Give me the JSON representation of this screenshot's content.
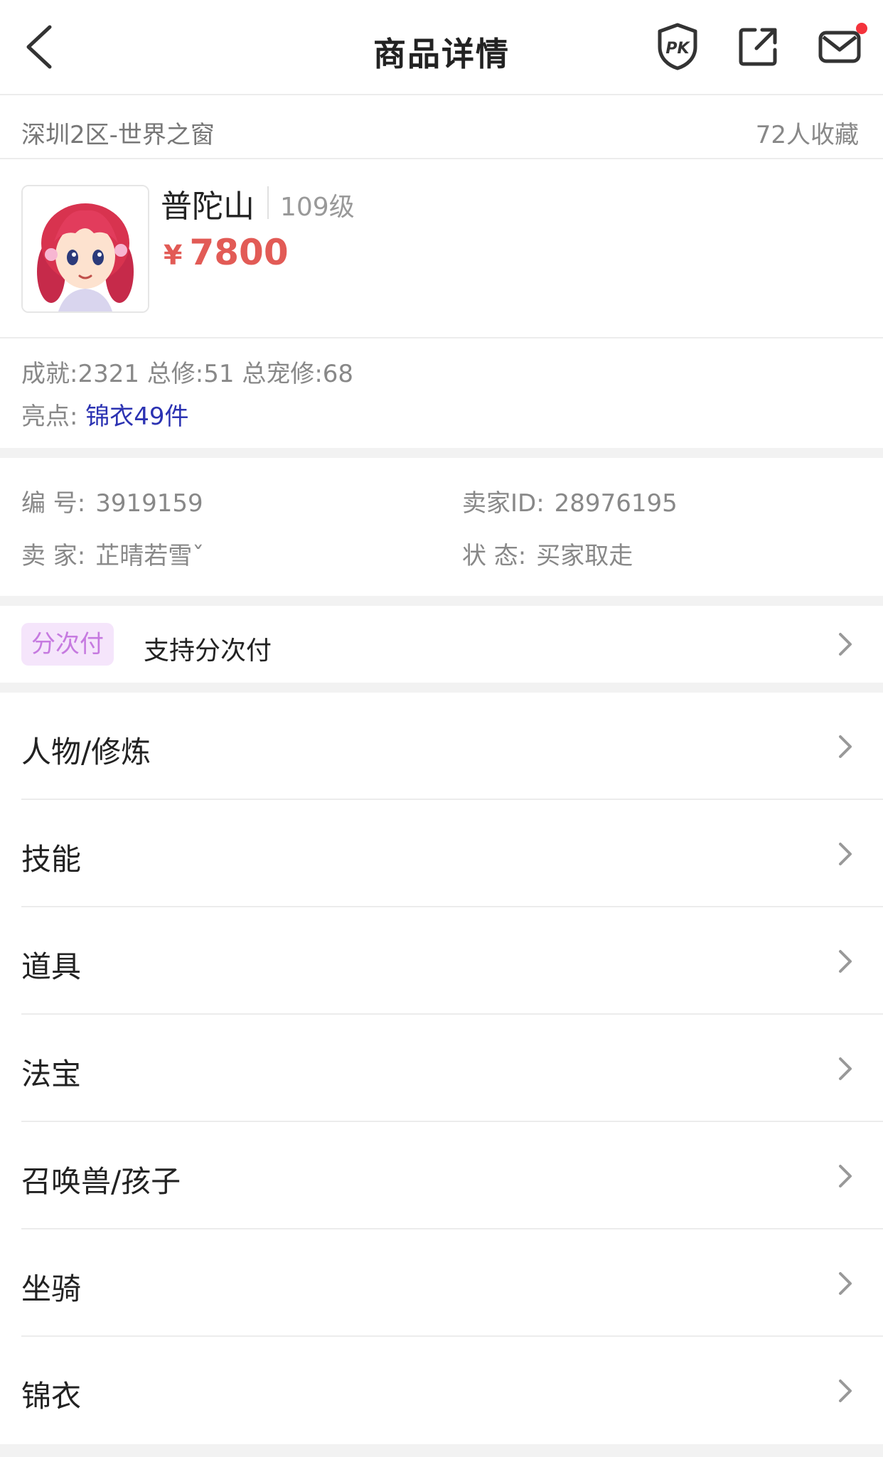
{
  "header": {
    "title": "商品详情"
  },
  "server": {
    "name": "深圳2区-世界之窗",
    "favorites": "72人收藏"
  },
  "product": {
    "role": "普陀山",
    "level": "109级",
    "currency": "¥",
    "price": "7800"
  },
  "stats": {
    "line": "成就:2321 总修:51 总宠修:68",
    "highlight_label": "亮点:",
    "highlight_value": "锦衣49件"
  },
  "info": {
    "number_label": "编 号:",
    "number_value": "3919159",
    "seller_id_label": "卖家ID:",
    "seller_id_value": "28976195",
    "seller_label": "卖 家:",
    "seller_value": "芷晴若雪ˇ",
    "status_label": "状 态:",
    "status_value": "买家取走"
  },
  "installment": {
    "tag": "分次付",
    "text": "支持分次付"
  },
  "menu": {
    "items": [
      {
        "label": "人物/修炼"
      },
      {
        "label": "技能"
      },
      {
        "label": "道具"
      },
      {
        "label": "法宝"
      },
      {
        "label": "召唤兽/孩子"
      },
      {
        "label": "坐骑"
      },
      {
        "label": "锦衣"
      }
    ]
  },
  "colors": {
    "price": "#e25b56",
    "highlight": "#2b32b2",
    "tag_bg": "#f5e5fb",
    "tag_text": "#c67ae0",
    "badge": "#f4333c"
  }
}
